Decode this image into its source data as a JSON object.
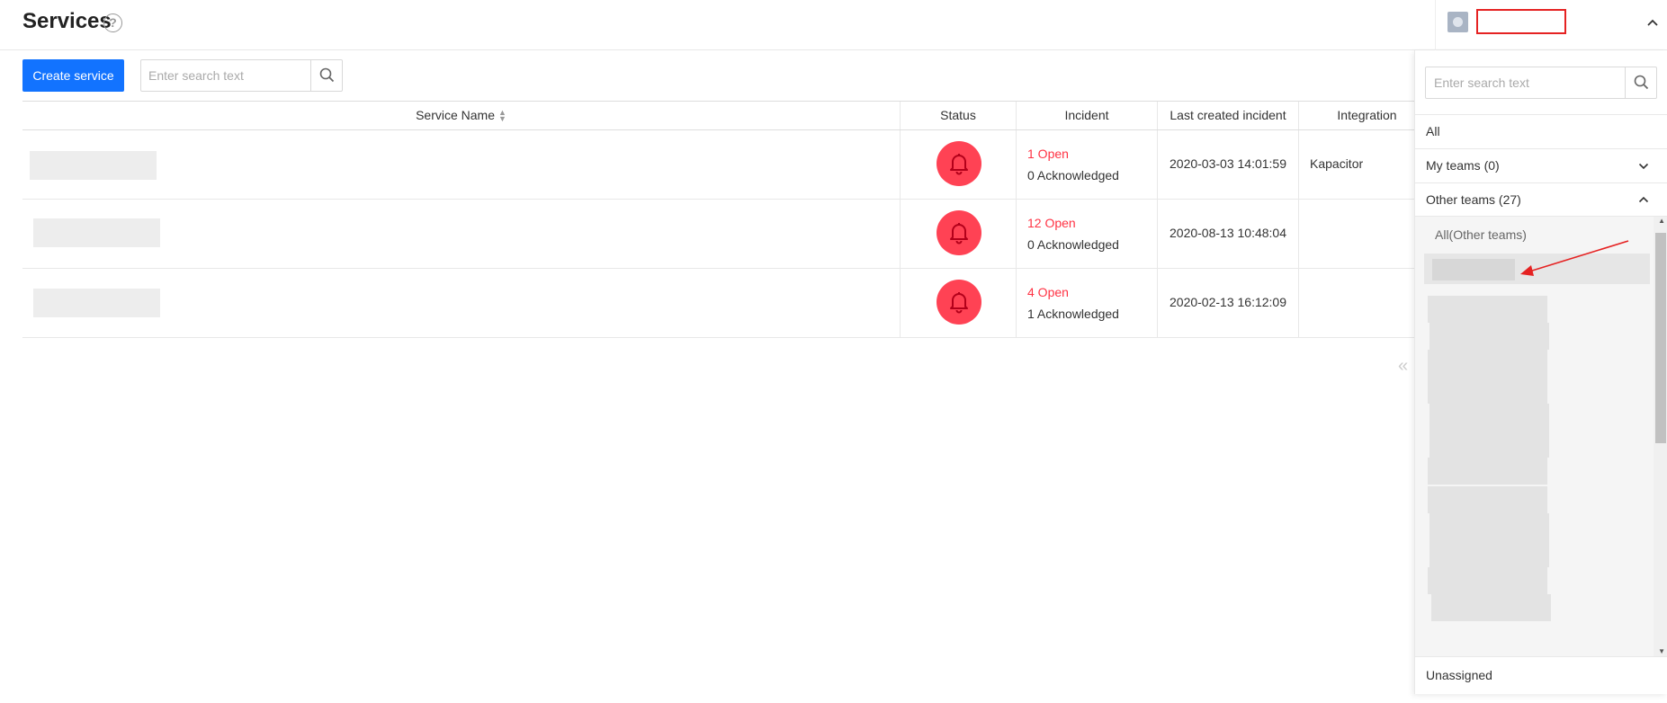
{
  "header": {
    "title": "Services",
    "help_symbol": "?",
    "collapse_symbol": "^"
  },
  "toolbar": {
    "create_label": "Create service",
    "search_placeholder": "Enter search text"
  },
  "table": {
    "columns": [
      "Service Name",
      "Status",
      "Incident",
      "Last created incident",
      "Integration"
    ],
    "rows": [
      {
        "open": "1 Open",
        "acknowledged": "0 Acknowledged",
        "last_incident": "2020-03-03 14:01:59",
        "integration": "Kapacitor"
      },
      {
        "open": "12 Open",
        "acknowledged": "0 Acknowledged",
        "last_incident": "2020-08-13 10:48:04",
        "integration": ""
      },
      {
        "open": "4 Open",
        "acknowledged": "1 Acknowledged",
        "last_incident": "2020-02-13 16:12:09",
        "integration": ""
      }
    ],
    "pager_symbol": "«"
  },
  "team_panel": {
    "search_placeholder": "Enter search text",
    "all_label": "All",
    "my_teams_label": "My teams (0)",
    "other_teams_label": "Other teams (27)",
    "other_teams_all_label": "All(Other teams)",
    "unassigned_label": "Unassigned"
  },
  "colors": {
    "primary": "#1273ff",
    "alert": "#ff4254",
    "open_text": "#ff3344",
    "annotation": "#e52222"
  }
}
